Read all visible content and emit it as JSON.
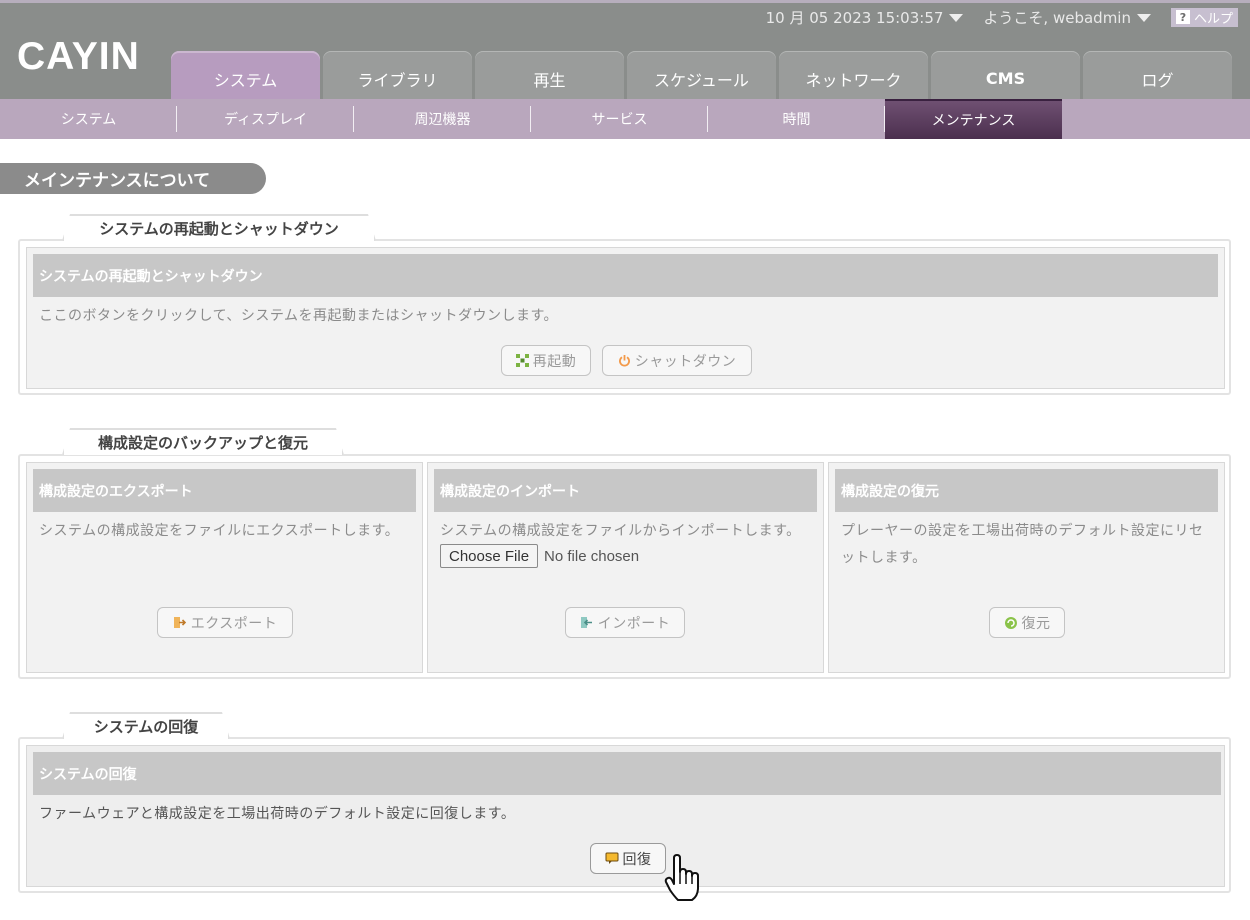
{
  "header": {
    "brand": "CAYIN",
    "datetime": "10 月 05 2023 15:03:57",
    "welcome": "ようこそ, webadmin",
    "help": "ヘルプ",
    "tabs": [
      {
        "label": "システム",
        "active": true
      },
      {
        "label": "ライブラリ"
      },
      {
        "label": "再生"
      },
      {
        "label": "スケジュール"
      },
      {
        "label": "ネットワーク"
      },
      {
        "label": "CMS"
      },
      {
        "label": "ログ"
      }
    ]
  },
  "subnav": {
    "items": [
      {
        "label": "システム"
      },
      {
        "label": "ディスプレイ"
      },
      {
        "label": "周辺機器"
      },
      {
        "label": "サービス"
      },
      {
        "label": "時間"
      },
      {
        "label": "メンテナンス",
        "active": true
      }
    ]
  },
  "page": {
    "title": "メインテナンスについて"
  },
  "reboot_section": {
    "tab": "システムの再起動とシャットダウン",
    "header": "システムの再起動とシャットダウン",
    "description": "ここのボタンをクリックして、システムを再起動またはシャットダウンします。",
    "restart_label": "再起動",
    "shutdown_label": "シャットダウン"
  },
  "backup_section": {
    "tab": "構成設定のバックアップと復元",
    "export": {
      "header": "構成設定のエクスポート",
      "description": "システムの構成設定をファイルにエクスポートします。",
      "button": "エクスポート"
    },
    "import": {
      "header": "構成設定のインポート",
      "description": "システムの構成設定をファイルからインポートします。",
      "file_button": "Choose File",
      "file_status": "No file chosen",
      "button": "インポート"
    },
    "restore": {
      "header": "構成設定の復元",
      "description": "プレーヤーの設定を工場出荷時のデフォルト設定にリセットします。",
      "button": "復元"
    }
  },
  "recovery_section": {
    "tab": "システムの回復",
    "header": "システムの回復",
    "description": "ファームウェアと構成設定を工場出荷時のデフォルト設定に回復します。",
    "button": "回復"
  }
}
